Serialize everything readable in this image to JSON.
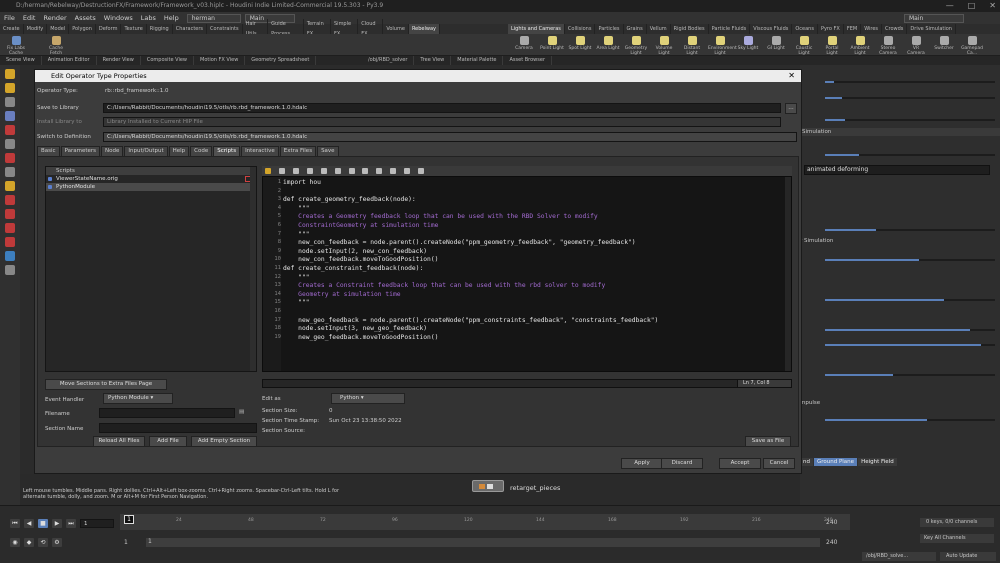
{
  "window": {
    "path": "D:/herman/Rebelway/DestructionFX/Framework/Framework_v03.hiplc - Houdini Indie Limited-Commercial 19.5.303 - Py3.9",
    "controls": [
      "—",
      "□",
      "✕"
    ]
  },
  "menubar": {
    "items": [
      "File",
      "Edit",
      "Render",
      "Assets",
      "Windows",
      "Labs",
      "Help"
    ],
    "desktop_left": "herman",
    "desktop_right": "Main",
    "desktop_far": "Main"
  },
  "shelf": {
    "left_tabs": [
      "Create",
      "Modify",
      "Model",
      "Polygon",
      "Deform",
      "Texture",
      "Rigging",
      "Characters",
      "Constraints",
      "Hair Utils",
      "Guide Process",
      "Terrain FX",
      "Simple FX",
      "Cloud FX",
      "Volume",
      "Rebelway"
    ],
    "right_tabs": [
      "Lights and Cameras",
      "Collisions",
      "Particles",
      "Grains",
      "Vellum",
      "Rigid Bodies",
      "Particle Fluids",
      "Viscous Fluids",
      "Oceans",
      "Pyro FX",
      "FEM",
      "Wires",
      "Crowds",
      "Drive Simulation"
    ],
    "left_tools": [
      "Fix Labs Cache",
      "Cache Fetch"
    ],
    "right_tools": [
      "Camera",
      "Point Light",
      "Spot Light",
      "Area Light",
      "Geometry Light",
      "Volume Light",
      "Distant Light",
      "Environment Light",
      "Sky Light",
      "GI Light",
      "Caustic Light",
      "Portal Light",
      "Ambient Light",
      "Stereo Camera",
      "VR Camera",
      "Switcher",
      "Gamepad Ca..."
    ]
  },
  "pane_tabs": [
    "Scene View",
    "Animation Editor",
    "Render View",
    "Composite View",
    "Motion FX View",
    "Geometry Spreadsheet",
    "/obj/RBD_solver",
    "Tree View",
    "Material Palette",
    "Asset Browser"
  ],
  "dialog": {
    "title": "Edit Operator Type Properties",
    "operator_type_label": "Operator Type:",
    "operator_type_value": "rb::rbd_framework::1.0",
    "save_to_library_label": "Save to Library",
    "save_to_library_value": "C:/Users/Rabbit/Documents/houdini19.5/otls/rb.rbd_framework.1.0.hdalc",
    "install_library_label": "Install Library to",
    "install_library_value": "Library Installed to Current HIP File",
    "switch_definition_label": "Switch to Definition",
    "switch_definition_value": "C:/Users/Rabbit/Documents/houdini19.5/otls/rb.rbd_framework.1.0.hdalc",
    "tabs": [
      "Basic",
      "Parameters",
      "Node",
      "Input/Output",
      "Help",
      "Code",
      "Scripts",
      "Interactive",
      "Extra Files",
      "Save"
    ],
    "active_tab": "Scripts",
    "scripts_header": "Scripts",
    "scripts": [
      "ViewerStateName.orig",
      "PythonModule"
    ],
    "selected_script": "PythonModule",
    "move_sections_button": "Move Sections to Extra Files Page",
    "event_handler_label": "Event Handler",
    "event_handler_value": "Python Module",
    "filename_label": "Filename",
    "section_name_label": "Section Name",
    "reload_all_button": "Reload All Files",
    "add_file_button": "Add File",
    "add_empty_button": "Add Empty Section",
    "code_lines": [
      {
        "n": "1",
        "t": "import hou"
      },
      {
        "n": "2",
        "t": ""
      },
      {
        "n": "3",
        "t": "def create_geometry_feedback(node):"
      },
      {
        "n": "4",
        "t": "    \"\"\""
      },
      {
        "n": "5",
        "t": "    Creates a Geometry feedback loop that can be used with the RBD Solver to modify"
      },
      {
        "n": "6",
        "t": "    ConstraintGeometry at simulation time"
      },
      {
        "n": "7",
        "t": "    \"\"\""
      },
      {
        "n": "8",
        "t": "    new_con_feedback = node.parent().createNode(\"ppm_geometry_feedback\", \"geometry_feedback\")"
      },
      {
        "n": "9",
        "t": "    node.setInput(2, new_con_feedback)"
      },
      {
        "n": "10",
        "t": "    new_con_feedback.moveToGoodPosition()"
      },
      {
        "n": "11",
        "t": "def create_constraint_feedback(node):"
      },
      {
        "n": "12",
        "t": "    \"\"\""
      },
      {
        "n": "13",
        "t": "    Creates a Constraint feedback loop that can be used with the rbd solver to modify"
      },
      {
        "n": "14",
        "t": "    Geometry at simulation time"
      },
      {
        "n": "15",
        "t": "    \"\"\""
      },
      {
        "n": "16",
        "t": ""
      },
      {
        "n": "17",
        "t": "    new_geo_feedback = node.parent().createNode(\"ppm_constraints_feedback\", \"constraints_feedback\")"
      },
      {
        "n": "18",
        "t": "    node.setInput(3, new_geo_feedback)"
      },
      {
        "n": "19",
        "t": "    new_geo_feedback.moveToGoodPosition()"
      }
    ],
    "cursor_status": "Ln 7, Col 8",
    "edit_as_label": "Edit as",
    "edit_as_value": "Python",
    "section_size_label": "Section Size:",
    "section_size_value": "0",
    "section_time_label": "Section Time Stamp:",
    "section_time_value": "Sun Oct 23 13:38:50 2022",
    "section_source_label": "Section Source:",
    "save_as_file_button": "Save as File",
    "apply_button": "Apply",
    "discard_button": "Discard",
    "accept_button": "Accept",
    "cancel_button": "Cancel"
  },
  "right_panel": {
    "simulation_label": "Simulation",
    "animated_deforming": "animated deforming",
    "simulation_label2": "r Simulation",
    "impulse_label": "mpulse",
    "bottom_tabs": [
      "nd",
      "Ground Plane",
      "Height Field"
    ],
    "sliders": [
      0.05,
      0.1,
      0.12,
      0.2,
      0.3,
      0.55,
      0.7,
      0.85,
      0.92,
      0.4,
      0.6
    ]
  },
  "network": {
    "node_name": "retarget_pieces"
  },
  "help_text": "Left mouse tumbles. Middle pans. Right dollies. Ctrl+Alt+Left box-zooms. Ctrl+Right zooms. Spacebar-Ctrl-Left tilts. Hold L for alternate tumble, dolly, and zoom.   M or Alt+M for First Person Navigation.",
  "timeline": {
    "frame": "1",
    "start": "1",
    "start2": "1",
    "end": "240",
    "end2": "240",
    "ticks": [
      "24",
      "48",
      "72",
      "96",
      "120",
      "144",
      "168",
      "192",
      "216",
      "240"
    ],
    "keys_label": "0 keys, 0/0 channels",
    "key_all_label": "Key All Channels",
    "path_label": "/obj/RBD_solve...",
    "auto_update": "Auto Update"
  }
}
